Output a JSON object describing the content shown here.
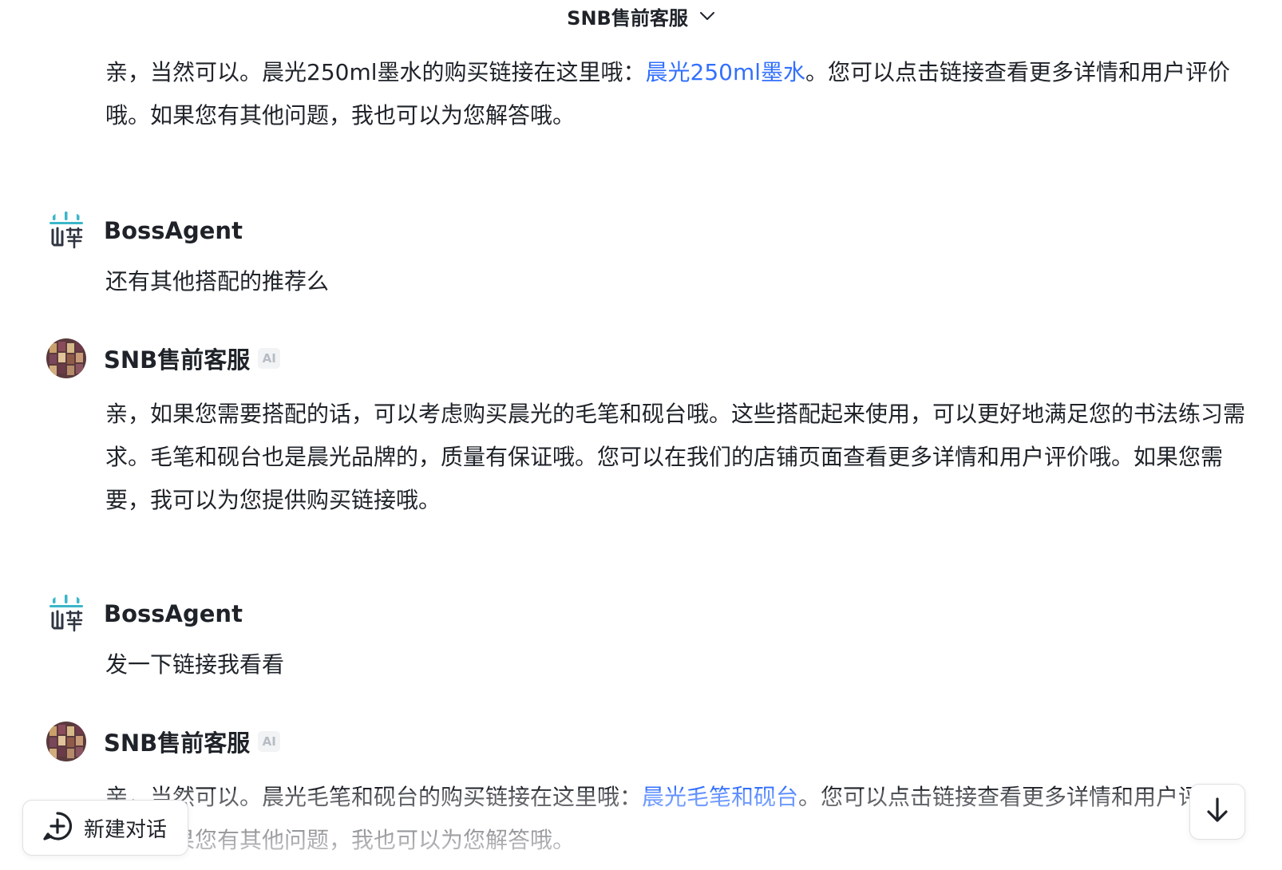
{
  "header": {
    "title": "SNB售前客服"
  },
  "messages": [
    {
      "text_before": "亲，当然可以。晨光250ml墨水的购买链接在这里哦：",
      "link": "晨光250ml墨水",
      "text_after": "。您可以点击链接查看更多详情和用户评价哦。如果您有其他问题，我也可以为您解答哦。"
    },
    {
      "sender": "BossAgent",
      "text": "还有其他搭配的推荐么"
    },
    {
      "sender": "SNB售前客服",
      "badge": "AI",
      "text": "亲，如果您需要搭配的话，可以考虑购买晨光的毛笔和砚台哦。这些搭配起来使用，可以更好地满足您的书法练习需求。毛笔和砚台也是晨光品牌的，质量有保证哦。您可以在我们的店铺页面查看更多详情和用户评价哦。如果您需要，我可以为您提供购买链接哦。"
    },
    {
      "sender": "BossAgent",
      "text": "发一下链接我看看"
    },
    {
      "sender": "SNB售前客服",
      "badge": "AI",
      "text_before": "亲，当然可以。晨光毛笔和砚台的购买链接在这里哦：",
      "link": "晨光毛笔和砚台",
      "text_after": "。您可以点击链接查看更多详情和用户评价哦。如果您有其他问题，我也可以为您解答哦。"
    }
  ],
  "footer": {
    "new_chat_label": "新建对话"
  },
  "colors": {
    "link": "#3370ff",
    "text": "#1f2329",
    "badge_bg": "#f2f3f5"
  }
}
